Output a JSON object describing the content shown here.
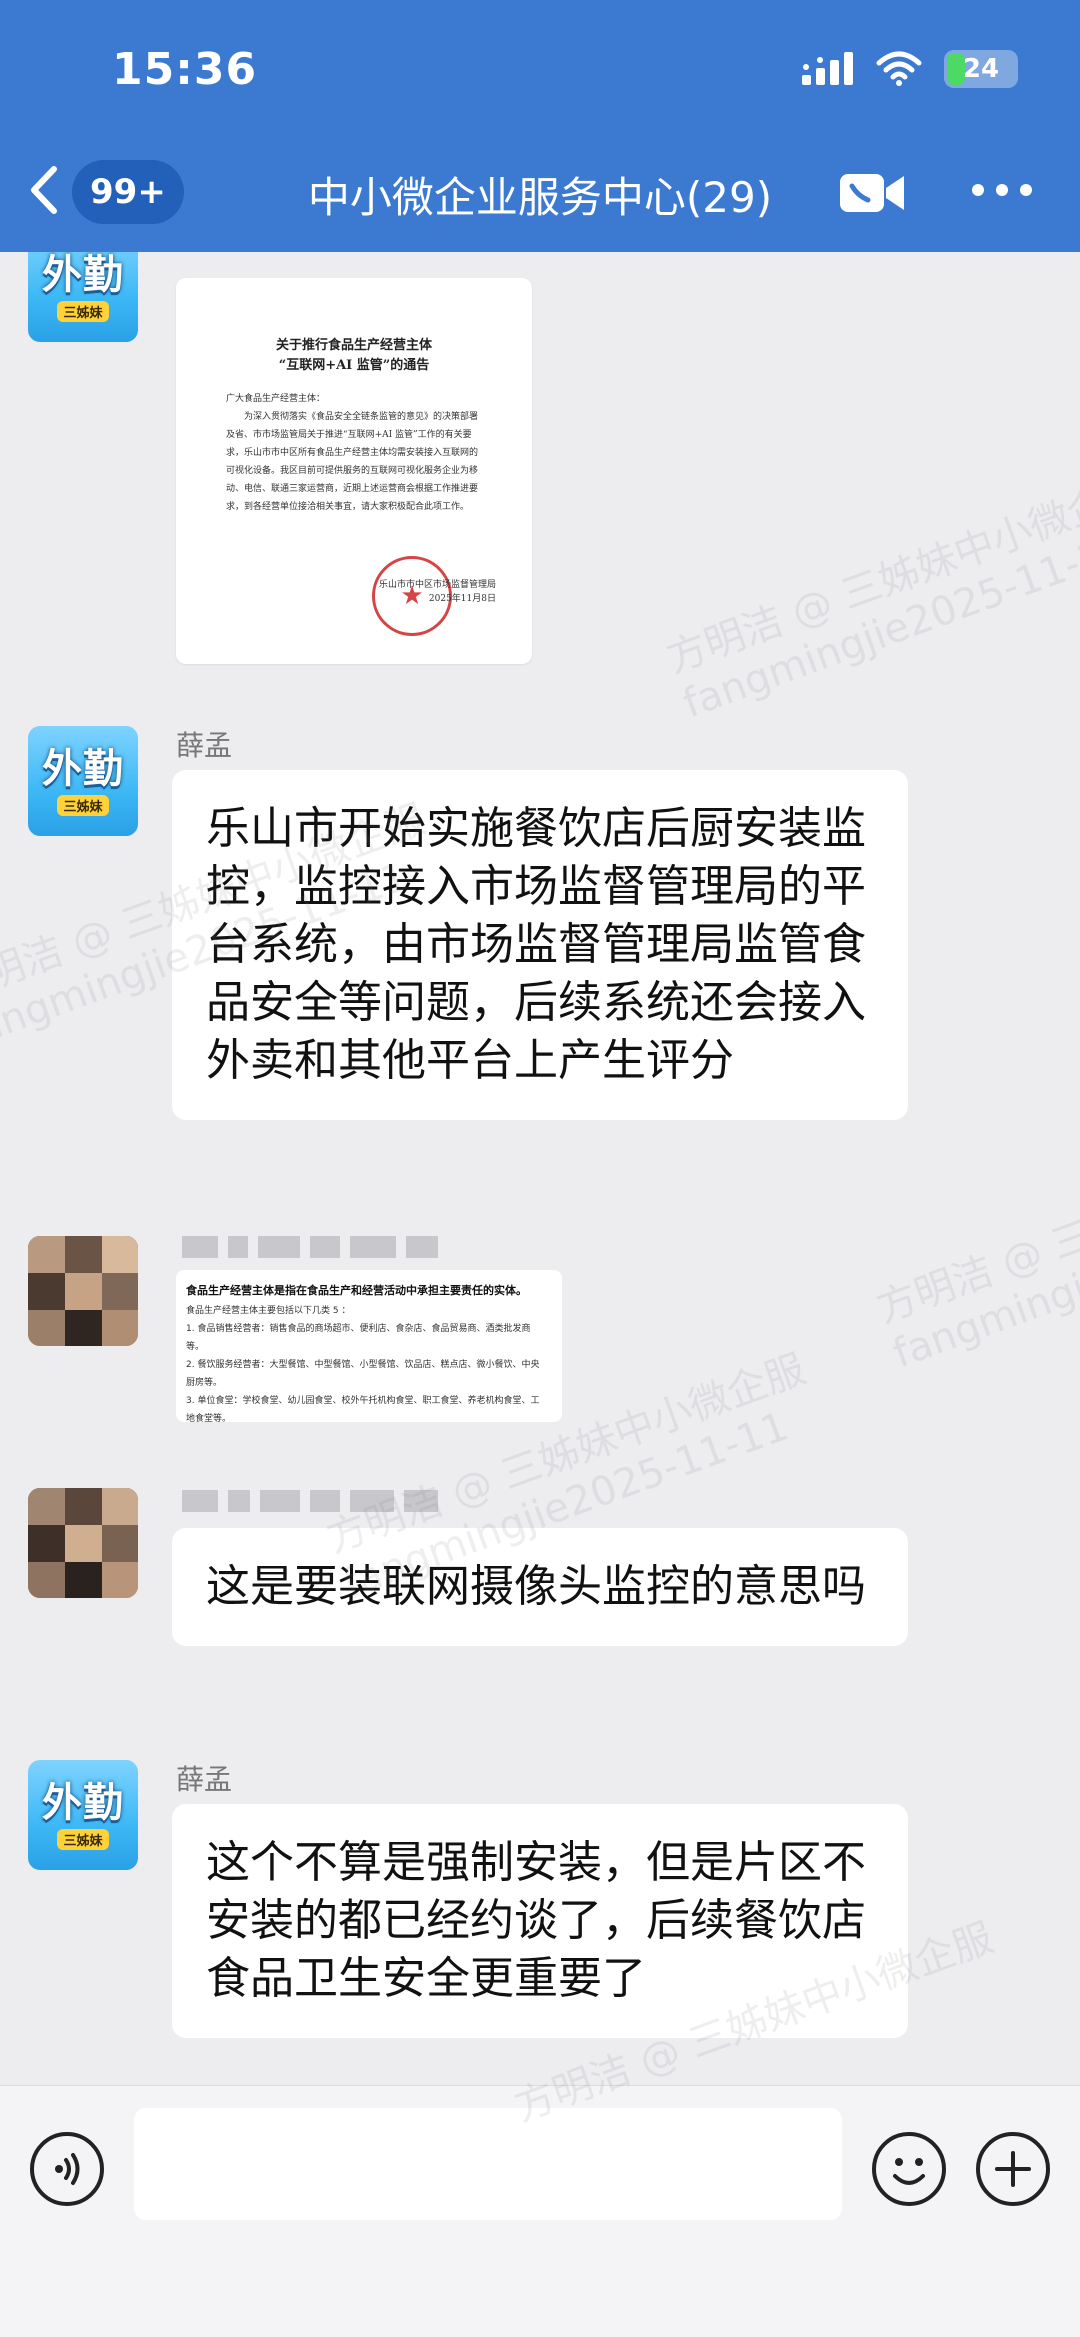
{
  "status_bar": {
    "time": "15:36",
    "battery": "24",
    "icons": [
      "signal-icon",
      "wifi-icon",
      "battery-icon"
    ]
  },
  "header": {
    "badge": "99+",
    "title": "中小微企业服务中心(29)",
    "icons": [
      "back-icon",
      "video-call-icon",
      "more-icon"
    ]
  },
  "avatar_brand": {
    "big": "外勤",
    "small": "三姊妹"
  },
  "messages": [
    {
      "sender": "薛孟",
      "doc": {
        "title_line1": "关于推行食品生产经营主体",
        "title_line2": "“互联网+AI 监管”的通告",
        "greeting": "广大食品生产经营主体：",
        "body": "为深入贯彻落实《食品安全全链条监管的意见》的决策部署及省、市市场监管局关于推进“互联网+AI 监管”工作的有关要求，乐山市市中区所有食品生产经营主体均需安装接入互联网的可视化设备。我区目前可提供服务的互联网可视化服务企业为移动、电信、联通三家运营商，近期上述运营商会根据工作推进要求，到各经营单位接洽相关事宜，请大家积极配合此项工作。",
        "sign": "乐山市市中区市场监督管理局",
        "sign_date": "2025年11月8日"
      }
    },
    {
      "sender": "薛孟",
      "text": "乐山市开始实施餐饮店后厨安装监控，监控接入市场监督管理局的平台系统，由市场监督管理局监管食品安全等问题，后续系统还会接入外卖和其他平台上产生评分"
    },
    {
      "card": {
        "heading": "食品生产经营主体是指在食品生产和经营活动中承担主要责任的实体。",
        "intro": "食品生产经营主体主要包括以下几类 5 ：",
        "items": [
          "1. 食品销售经营者：销售食品的商场超市、便利店、食杂店、食品贸易商、酒类批发商等。",
          "2. 餐饮服务经营者：大型餐馆、中型餐馆、小型餐馆、饮品店、糕点店、微小餐饮、中央厨房等。",
          "3. 单位食堂：学校食堂、幼儿园食堂、校外午托机构食堂、职工食堂、养老机构食堂、工地食堂等。"
        ]
      }
    },
    {
      "text": "这是要装联网摄像头监控的意思吗"
    },
    {
      "sender": "薛孟",
      "text": "这个不算是强制安装，但是片区不安装的都已经约谈了，后续餐饮店食品卫生安全更重要了"
    }
  ],
  "watermark": {
    "line1": "方明洁 @ 三姊妹中小微企服",
    "line2": "fangmingjie2025-11-11"
  },
  "bottom_bar": {
    "input_placeholder": "",
    "icons": [
      "voice-icon",
      "emoji-icon",
      "plus-icon"
    ]
  }
}
